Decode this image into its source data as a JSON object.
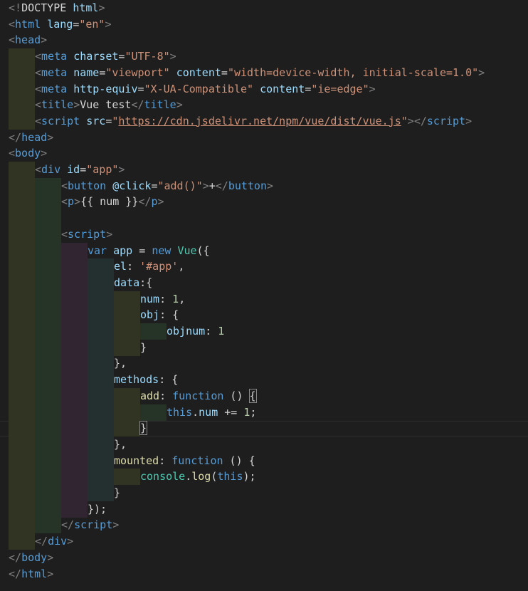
{
  "editor": {
    "theme": {
      "background": "#1e1e1e",
      "indent_colors": [
        "#323423",
        "#263327",
        "#312532",
        "#24302f"
      ]
    },
    "lines": [
      {
        "indent": 0,
        "tokens": [
          {
            "c": "t-punc",
            "t": "<!"
          },
          {
            "c": "t-text",
            "t": "DOCTYPE"
          },
          {
            "c": "t-text",
            "t": " "
          },
          {
            "c": "t-attr",
            "t": "html"
          },
          {
            "c": "t-punc",
            "t": ">"
          }
        ]
      },
      {
        "indent": 0,
        "tokens": [
          {
            "c": "t-punc",
            "t": "<"
          },
          {
            "c": "t-tag",
            "t": "html"
          },
          {
            "c": "t-text",
            "t": " "
          },
          {
            "c": "t-attr",
            "t": "lang"
          },
          {
            "c": "t-text",
            "t": "="
          },
          {
            "c": "t-str",
            "t": "\"en\""
          },
          {
            "c": "t-punc",
            "t": ">"
          }
        ]
      },
      {
        "indent": 0,
        "tokens": [
          {
            "c": "t-punc",
            "t": "<"
          },
          {
            "c": "t-tag",
            "t": "head"
          },
          {
            "c": "t-punc",
            "t": ">"
          }
        ]
      },
      {
        "indent": 1,
        "tokens": [
          {
            "c": "t-punc",
            "t": "<"
          },
          {
            "c": "t-tag",
            "t": "meta"
          },
          {
            "c": "t-text",
            "t": " "
          },
          {
            "c": "t-attr",
            "t": "charset"
          },
          {
            "c": "t-text",
            "t": "="
          },
          {
            "c": "t-str",
            "t": "\"UTF-8\""
          },
          {
            "c": "t-punc",
            "t": ">"
          }
        ]
      },
      {
        "indent": 1,
        "tokens": [
          {
            "c": "t-punc",
            "t": "<"
          },
          {
            "c": "t-tag",
            "t": "meta"
          },
          {
            "c": "t-text",
            "t": " "
          },
          {
            "c": "t-attr",
            "t": "name"
          },
          {
            "c": "t-text",
            "t": "="
          },
          {
            "c": "t-str",
            "t": "\"viewport\""
          },
          {
            "c": "t-text",
            "t": " "
          },
          {
            "c": "t-attr",
            "t": "content"
          },
          {
            "c": "t-text",
            "t": "="
          },
          {
            "c": "t-str",
            "t": "\"width=device-width, initial-scale=1.0\""
          },
          {
            "c": "t-punc",
            "t": ">"
          }
        ]
      },
      {
        "indent": 1,
        "tokens": [
          {
            "c": "t-punc",
            "t": "<"
          },
          {
            "c": "t-tag",
            "t": "meta"
          },
          {
            "c": "t-text",
            "t": " "
          },
          {
            "c": "t-attr",
            "t": "http-equiv"
          },
          {
            "c": "t-text",
            "t": "="
          },
          {
            "c": "t-str",
            "t": "\"X-UA-Compatible\""
          },
          {
            "c": "t-text",
            "t": " "
          },
          {
            "c": "t-attr",
            "t": "content"
          },
          {
            "c": "t-text",
            "t": "="
          },
          {
            "c": "t-str",
            "t": "\"ie=edge\""
          },
          {
            "c": "t-punc",
            "t": ">"
          }
        ]
      },
      {
        "indent": 1,
        "tokens": [
          {
            "c": "t-punc",
            "t": "<"
          },
          {
            "c": "t-tag",
            "t": "title"
          },
          {
            "c": "t-punc",
            "t": ">"
          },
          {
            "c": "t-text",
            "t": "Vue test"
          },
          {
            "c": "t-punc",
            "t": "</"
          },
          {
            "c": "t-tag",
            "t": "title"
          },
          {
            "c": "t-punc",
            "t": ">"
          }
        ]
      },
      {
        "indent": 1,
        "tokens": [
          {
            "c": "t-punc",
            "t": "<"
          },
          {
            "c": "t-tag",
            "t": "script"
          },
          {
            "c": "t-text",
            "t": " "
          },
          {
            "c": "t-attr",
            "t": "src"
          },
          {
            "c": "t-text",
            "t": "="
          },
          {
            "c": "t-str",
            "t": "\""
          },
          {
            "c": "t-link",
            "t": "https://cdn.jsdelivr.net/npm/vue/dist/vue.js"
          },
          {
            "c": "t-str",
            "t": "\""
          },
          {
            "c": "t-punc",
            "t": "></"
          },
          {
            "c": "t-tag",
            "t": "script"
          },
          {
            "c": "t-punc",
            "t": ">"
          }
        ]
      },
      {
        "indent": 0,
        "tokens": [
          {
            "c": "t-punc",
            "t": "</"
          },
          {
            "c": "t-tag",
            "t": "head"
          },
          {
            "c": "t-punc",
            "t": ">"
          }
        ]
      },
      {
        "indent": 0,
        "tokens": [
          {
            "c": "t-punc",
            "t": "<"
          },
          {
            "c": "t-tag",
            "t": "body"
          },
          {
            "c": "t-punc",
            "t": ">"
          }
        ]
      },
      {
        "indent": 1,
        "tokens": [
          {
            "c": "t-punc",
            "t": "<"
          },
          {
            "c": "t-tag",
            "t": "div"
          },
          {
            "c": "t-text",
            "t": " "
          },
          {
            "c": "t-attr",
            "t": "id"
          },
          {
            "c": "t-text",
            "t": "="
          },
          {
            "c": "t-str",
            "t": "\"app\""
          },
          {
            "c": "t-punc",
            "t": ">"
          }
        ]
      },
      {
        "indent": 2,
        "tokens": [
          {
            "c": "t-punc",
            "t": "<"
          },
          {
            "c": "t-tag",
            "t": "button"
          },
          {
            "c": "t-text",
            "t": " "
          },
          {
            "c": "t-attr",
            "t": "@click"
          },
          {
            "c": "t-text",
            "t": "="
          },
          {
            "c": "t-str",
            "t": "\"add()\""
          },
          {
            "c": "t-punc",
            "t": ">"
          },
          {
            "c": "t-text",
            "t": "+"
          },
          {
            "c": "t-punc",
            "t": "</"
          },
          {
            "c": "t-tag",
            "t": "button"
          },
          {
            "c": "t-punc",
            "t": ">"
          }
        ]
      },
      {
        "indent": 2,
        "tokens": [
          {
            "c": "t-punc",
            "t": "<"
          },
          {
            "c": "t-tag",
            "t": "p"
          },
          {
            "c": "t-punc",
            "t": ">"
          },
          {
            "c": "t-text",
            "t": "{{ num }}"
          },
          {
            "c": "t-punc",
            "t": "</"
          },
          {
            "c": "t-tag",
            "t": "p"
          },
          {
            "c": "t-punc",
            "t": ">"
          }
        ]
      },
      {
        "indent": 2,
        "tokens": []
      },
      {
        "indent": 2,
        "tokens": [
          {
            "c": "t-punc",
            "t": "<"
          },
          {
            "c": "t-tag",
            "t": "script"
          },
          {
            "c": "t-punc",
            "t": ">"
          }
        ]
      },
      {
        "indent": 3,
        "tokens": [
          {
            "c": "t-kw",
            "t": "var"
          },
          {
            "c": "t-text",
            "t": " "
          },
          {
            "c": "t-var",
            "t": "app"
          },
          {
            "c": "t-text",
            "t": " = "
          },
          {
            "c": "t-kw",
            "t": "new"
          },
          {
            "c": "t-text",
            "t": " "
          },
          {
            "c": "t-cls",
            "t": "Vue"
          },
          {
            "c": "t-text",
            "t": "({"
          }
        ]
      },
      {
        "indent": 4,
        "tokens": [
          {
            "c": "t-var",
            "t": "el"
          },
          {
            "c": "t-text",
            "t": ": "
          },
          {
            "c": "t-str",
            "t": "'#app'"
          },
          {
            "c": "t-text",
            "t": ","
          }
        ]
      },
      {
        "indent": 4,
        "tokens": [
          {
            "c": "t-var",
            "t": "data"
          },
          {
            "c": "t-text",
            "t": ":{"
          }
        ]
      },
      {
        "indent": 5,
        "tokens": [
          {
            "c": "t-var",
            "t": "num"
          },
          {
            "c": "t-text",
            "t": ": "
          },
          {
            "c": "t-num",
            "t": "1"
          },
          {
            "c": "t-text",
            "t": ","
          }
        ]
      },
      {
        "indent": 5,
        "tokens": [
          {
            "c": "t-var",
            "t": "obj"
          },
          {
            "c": "t-text",
            "t": ": {"
          }
        ]
      },
      {
        "indent": 6,
        "tokens": [
          {
            "c": "t-var",
            "t": "objnum"
          },
          {
            "c": "t-text",
            "t": ": "
          },
          {
            "c": "t-num",
            "t": "1"
          }
        ]
      },
      {
        "indent": 5,
        "tokens": [
          {
            "c": "t-text",
            "t": "}"
          }
        ]
      },
      {
        "indent": 4,
        "tokens": [
          {
            "c": "t-text",
            "t": "},"
          }
        ]
      },
      {
        "indent": 4,
        "tokens": [
          {
            "c": "t-var",
            "t": "methods"
          },
          {
            "c": "t-text",
            "t": ": {"
          }
        ]
      },
      {
        "indent": 5,
        "tokens": [
          {
            "c": "t-fn",
            "t": "add"
          },
          {
            "c": "t-text",
            "t": ": "
          },
          {
            "c": "t-kw",
            "t": "function"
          },
          {
            "c": "t-text",
            "t": " () "
          },
          {
            "c": "t-text t-match",
            "t": "{"
          }
        ]
      },
      {
        "indent": 6,
        "tokens": [
          {
            "c": "t-kw",
            "t": "this"
          },
          {
            "c": "t-text",
            "t": "."
          },
          {
            "c": "t-var",
            "t": "num"
          },
          {
            "c": "t-text",
            "t": " += "
          },
          {
            "c": "t-num",
            "t": "1"
          },
          {
            "c": "t-text",
            "t": ";"
          }
        ]
      },
      {
        "indent": 5,
        "current": true,
        "tokens": [
          {
            "c": "t-text t-match",
            "t": "}"
          }
        ]
      },
      {
        "indent": 4,
        "tokens": [
          {
            "c": "t-text",
            "t": "},"
          }
        ]
      },
      {
        "indent": 4,
        "tokens": [
          {
            "c": "t-fn",
            "t": "mounted"
          },
          {
            "c": "t-text",
            "t": ": "
          },
          {
            "c": "t-kw",
            "t": "function"
          },
          {
            "c": "t-text",
            "t": " () {"
          }
        ]
      },
      {
        "indent": 5,
        "tokens": [
          {
            "c": "t-cls",
            "t": "console"
          },
          {
            "c": "t-text",
            "t": "."
          },
          {
            "c": "t-fn",
            "t": "log"
          },
          {
            "c": "t-text",
            "t": "("
          },
          {
            "c": "t-kw",
            "t": "this"
          },
          {
            "c": "t-text",
            "t": ");"
          }
        ]
      },
      {
        "indent": 4,
        "tokens": [
          {
            "c": "t-text",
            "t": "}"
          }
        ]
      },
      {
        "indent": 3,
        "tokens": [
          {
            "c": "t-text",
            "t": "});"
          }
        ]
      },
      {
        "indent": 2,
        "tokens": [
          {
            "c": "t-punc",
            "t": "</"
          },
          {
            "c": "t-tag",
            "t": "script"
          },
          {
            "c": "t-punc",
            "t": ">"
          }
        ]
      },
      {
        "indent": 1,
        "tokens": [
          {
            "c": "t-punc",
            "t": "</"
          },
          {
            "c": "t-tag",
            "t": "div"
          },
          {
            "c": "t-punc",
            "t": ">"
          }
        ]
      },
      {
        "indent": 0,
        "tokens": [
          {
            "c": "t-punc",
            "t": "</"
          },
          {
            "c": "t-tag",
            "t": "body"
          },
          {
            "c": "t-punc",
            "t": ">"
          }
        ]
      },
      {
        "indent": 0,
        "tokens": [
          {
            "c": "t-punc",
            "t": "</"
          },
          {
            "c": "t-tag",
            "t": "html"
          },
          {
            "c": "t-punc",
            "t": ">"
          }
        ]
      }
    ]
  }
}
